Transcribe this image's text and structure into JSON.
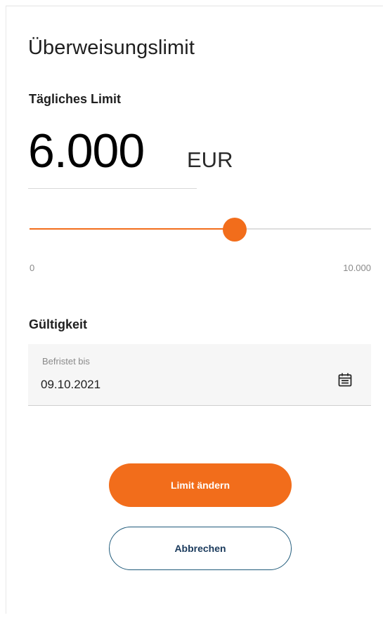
{
  "title": "Überweisungslimit",
  "daily_limit": {
    "label": "Tägliches Limit",
    "amount": "6.000",
    "currency": "EUR",
    "value": 6000
  },
  "slider": {
    "min": 0,
    "max": 10000,
    "value": 6000,
    "min_label": "0",
    "max_label": "10.000"
  },
  "validity": {
    "label": "Gültigkeit",
    "field_label": "Befristet bis",
    "field_value": "09.10.2021",
    "icon": "calendar-icon"
  },
  "actions": {
    "submit_label": "Limit ändern",
    "cancel_label": "Abbrechen"
  },
  "colors": {
    "accent": "#f26d1b",
    "secondary_border": "#1f5a7a"
  }
}
